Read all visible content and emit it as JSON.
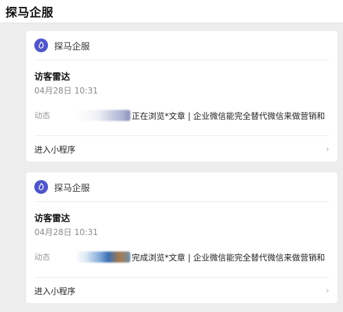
{
  "page": {
    "title": "探马企服"
  },
  "cards": [
    {
      "brand": "探马企服",
      "title": "访客雷达",
      "time": "04月28日 10:31",
      "label": "动态",
      "content": "正在浏览*文章 | 企业微信能完全替代微信来做营销和",
      "footer": "进入小程序"
    },
    {
      "brand": "探马企服",
      "title": "访客雷达",
      "time": "04月28日 10:31",
      "label": "动态",
      "content": "完成浏览*文章 | 企业微信能完全替代微信来做营销和",
      "footer": "进入小程序"
    }
  ],
  "icons": {
    "logo": "brand-logo-icon",
    "chevron": "chevron-right-icon"
  },
  "colors": {
    "logo": "#4f55c8",
    "background": "#ededed"
  }
}
